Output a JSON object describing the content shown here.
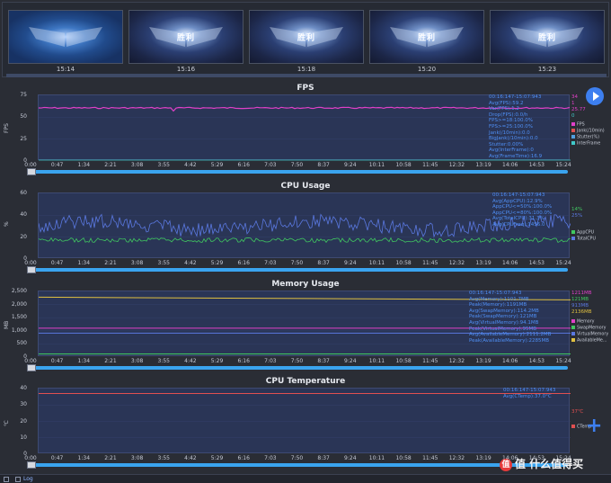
{
  "thumbnails": [
    {
      "time": "15:14",
      "crest": ""
    },
    {
      "time": "15:16",
      "crest": "胜利"
    },
    {
      "time": "15:18",
      "crest": "胜利"
    },
    {
      "time": "15:20",
      "crest": "胜利"
    },
    {
      "time": "15:23",
      "crest": "胜利"
    }
  ],
  "x_ticks": [
    "0:00",
    "0:47",
    "1:34",
    "2:21",
    "3:08",
    "3:55",
    "4:42",
    "5:29",
    "6:16",
    "7:03",
    "7:50",
    "8:37",
    "9:24",
    "10:11",
    "10:58",
    "11:45",
    "12:32",
    "13:19",
    "14:06",
    "14:53",
    "15:24"
  ],
  "panels": {
    "fps": {
      "title": "FPS",
      "ylabel": "FPS",
      "yticks": [
        "75",
        "50",
        "25",
        "0"
      ],
      "stats": [
        "00:16:147-15:07:943",
        "Avg(FPS):59.2",
        "Var(FPS):1.2",
        "Drop(FPS):0.0/h",
        "FPS>=18:100.0%",
        "FPS>=25:100.0%",
        "Jank(/10min):0.0",
        "BigJank(/10min):0.0",
        "Stutter:0.00%",
        "Avg(InterFrame):0",
        "Avg(FrameTime):16.9"
      ],
      "right_values": [
        "34",
        "1",
        "25.77",
        "0"
      ],
      "right_colors": [
        "#e040c8",
        "#e040c8",
        "#e040c8",
        "#40c8c8"
      ],
      "legend": [
        {
          "label": "FPS",
          "color": "#e040c8"
        },
        {
          "label": "Jank(/10min)",
          "color": "#e05050"
        },
        {
          "label": "Stutter(%)",
          "color": "#50a0e0"
        },
        {
          "label": "InterFrame",
          "color": "#40c8c8"
        }
      ]
    },
    "cpu": {
      "title": "CPU Usage",
      "ylabel": "%",
      "yticks": [
        "60",
        "40",
        "20",
        "0"
      ],
      "stats": [
        "00:16:147-15:07:943",
        "Avg(AppCPU):12.9%",
        "AppCPU<=50%:100.0%",
        "AppCPU<=80%:100.0%",
        "Avg(TotalCPU):31.3%",
        "Avg(CPUFreq):1456.0"
      ],
      "right_values": [
        "14%",
        "25%"
      ],
      "right_colors": [
        "#40c860",
        "#5a78e0"
      ],
      "legend": [
        {
          "label": "AppCPU",
          "color": "#40c860"
        },
        {
          "label": "TotalCPU",
          "color": "#5a78e0"
        }
      ]
    },
    "memory": {
      "title": "Memory Usage",
      "ylabel": "MB",
      "yticks": [
        "2,500",
        "2,000",
        "1,500",
        "1,000",
        "500",
        "0"
      ],
      "stats": [
        "00:16:147-15:07:943",
        "Avg(Memory):1101.7MB",
        "Peak(Memory):1191MB",
        "Avg(SwapMemory):114.2MB",
        "Peak(SwapMemory):121MB",
        "Avg(VirtualMemory):94.1MB",
        "Peak(VirtualMemory):95MB",
        "Avg(AvailableMemory):2111.2MB",
        "Peak(AvailableMemory):2285MB"
      ],
      "right_values": [
        "1211MB",
        "121MB",
        "913MB",
        "2136MB"
      ],
      "right_colors": [
        "#e040c8",
        "#40c860",
        "#5a78e0",
        "#e0c040"
      ],
      "legend": [
        {
          "label": "Memory",
          "color": "#e040c8"
        },
        {
          "label": "SwapMemory",
          "color": "#40c860"
        },
        {
          "label": "VirtualMemory",
          "color": "#5a78e0"
        },
        {
          "label": "AvailableMe...",
          "color": "#e0c040"
        }
      ]
    },
    "temp": {
      "title": "CPU Temperature",
      "ylabel": "℃",
      "yticks": [
        "40",
        "30",
        "20",
        "10",
        "0"
      ],
      "stats": [
        "00:16:147-15:07:943",
        "Avg(CTemp):37.0°C"
      ],
      "right_values": [
        "37℃"
      ],
      "right_colors": [
        "#e05050"
      ],
      "legend": [
        {
          "label": "CTemp",
          "color": "#e05050"
        }
      ]
    }
  },
  "bottom": {
    "log_label": "Log"
  },
  "watermark": {
    "text": "值 什么值得买",
    "icon": "值"
  }
}
